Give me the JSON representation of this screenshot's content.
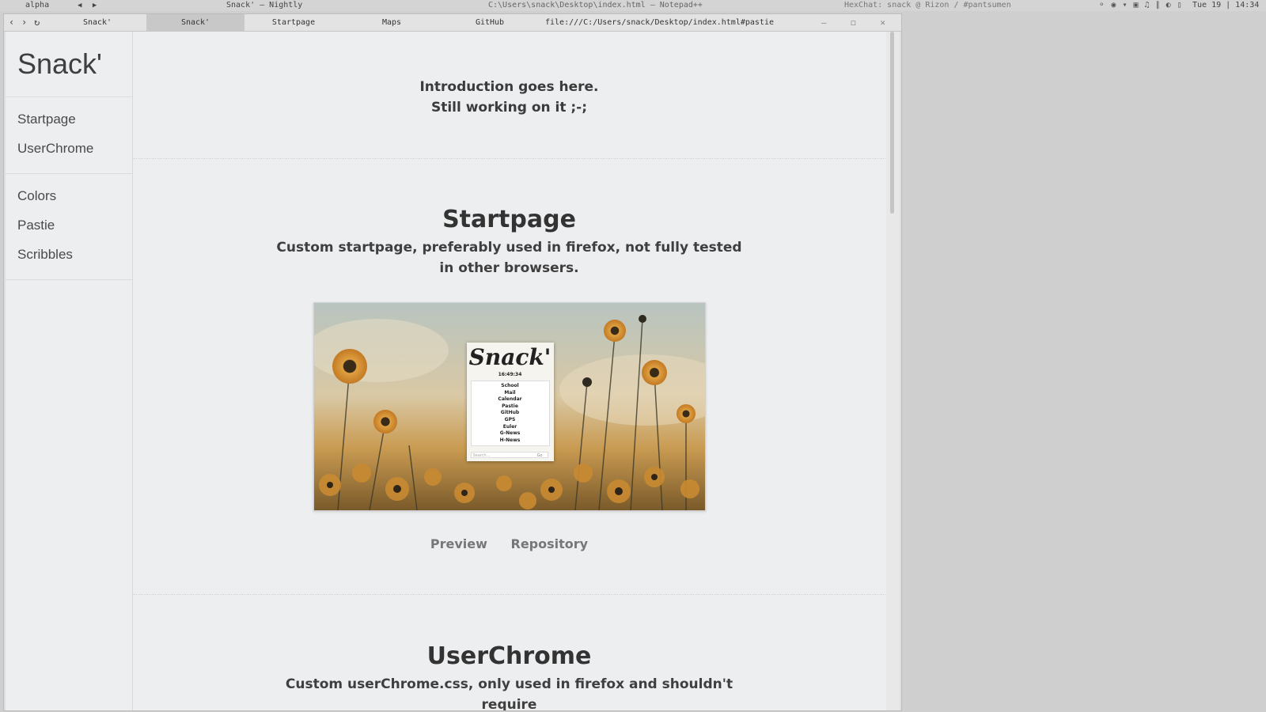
{
  "system_bar": {
    "workspace": "alpha",
    "workspace_arrows": "◀ ▶",
    "window_title_1": "Snack' — Nightly",
    "window_title_2": "C:\\Users\\snack\\Desktop\\index.html — Notepad++",
    "window_title_3": "HexChat: snack @ Rizon / #pantsumen",
    "tray_icons": "⚬ ◉ ▾ ▣ ♫ ∥ ◐ ▯",
    "clock": "Tue 19 | 14:34"
  },
  "browser": {
    "nav": {
      "back": "‹",
      "forward": "›",
      "reload": "↻"
    },
    "tabs": [
      {
        "label": "Snack'"
      },
      {
        "label": "Snack'"
      },
      {
        "label": "Startpage"
      },
      {
        "label": "Maps"
      },
      {
        "label": "GitHub"
      }
    ],
    "active_tab_index": 1,
    "url": "file:///C:/Users/snack/Desktop/index.html#pastie",
    "window_controls": "– ◻ ✕"
  },
  "sidebar": {
    "brand": "Snack'",
    "groups": [
      {
        "items": [
          {
            "label": "Startpage"
          },
          {
            "label": "UserChrome"
          }
        ]
      },
      {
        "items": [
          {
            "label": "Colors"
          },
          {
            "label": "Pastie"
          },
          {
            "label": "Scribbles"
          }
        ]
      }
    ]
  },
  "main": {
    "intro_line1": "Introduction goes here.",
    "intro_line2": "Still working on it ;-;",
    "startpage": {
      "title": "Startpage",
      "description": "Custom startpage, preferably used in firefox, not fully tested in other browsers.",
      "preview_link": "Preview",
      "repo_link": "Repository",
      "screenshot": {
        "card_title": "Snack'",
        "card_time": "16:49:34",
        "card_links": [
          "School",
          "Mail",
          "Calendar",
          "Pastie",
          "GitHub",
          "GPS",
          "Euler",
          "G-News",
          "H-News"
        ],
        "card_search_placeholder": "Search...",
        "card_go": "Go"
      }
    },
    "userchrome": {
      "title": "UserChrome",
      "description": "Custom userChrome.css, only used in firefox and shouldn't require"
    }
  },
  "colors": {
    "page_bg": "#eceef0",
    "text": "#3b3b3b",
    "link_muted": "#777777",
    "active_tab": "#c8c8c8"
  }
}
